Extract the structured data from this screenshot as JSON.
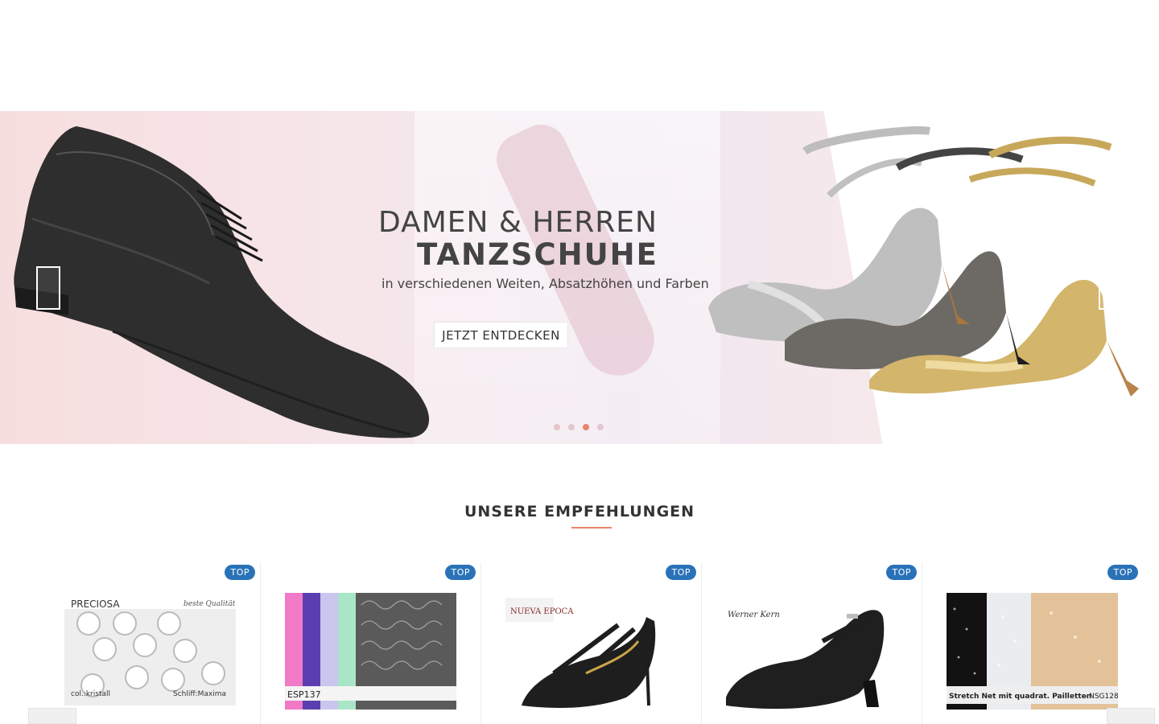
{
  "hero": {
    "title_line1": "DAMEN & HERREN",
    "title_line2": "TANZSCHUHE",
    "subtitle": "in verschiedenen Weiten, Absatzhöhen und Farben",
    "cta": "JETZT ENTDECKEN",
    "active_slide": 3,
    "slide_count": 4,
    "accent_color": "#e9846b"
  },
  "recommendations": {
    "title": "UNSERE EMPFEHLUNGEN",
    "items": [
      {
        "badge": "TOP",
        "thumb_text_brand": "PRECIOSA",
        "thumb_text_quality": "beste Qualität",
        "thumb_text_color": "col.:kristall",
        "thumb_text_cut": "Schliff:Maxima"
      },
      {
        "badge": "TOP",
        "thumb_text_code": "ESP137"
      },
      {
        "badge": "TOP",
        "thumb_text_brand": "NUEVA EPOCA"
      },
      {
        "badge": "TOP",
        "thumb_text_brand": "Werner Kern"
      },
      {
        "badge": "TOP",
        "thumb_text_caption": "Stretch Net mit quadrat. Pailletten",
        "thumb_text_code": "- NSG128"
      }
    ],
    "badge_color": "#2a72b8"
  }
}
